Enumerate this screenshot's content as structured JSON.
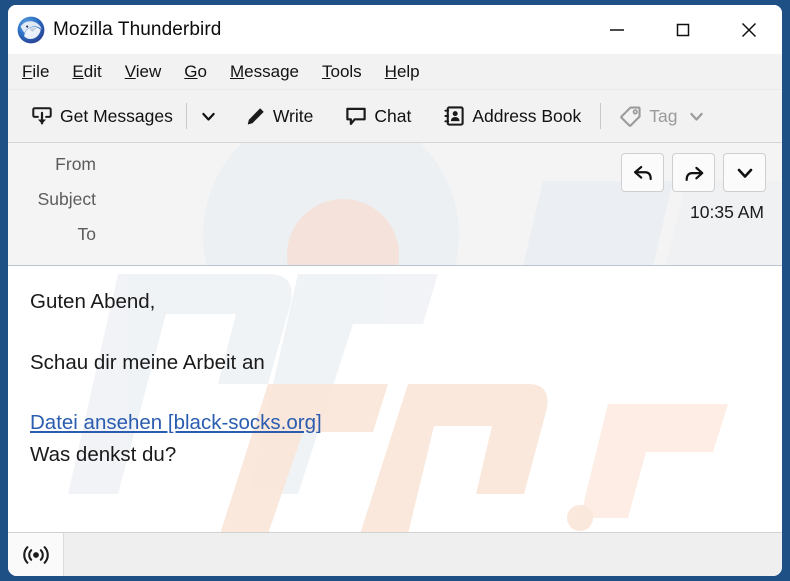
{
  "window": {
    "title": "Mozilla Thunderbird",
    "logo_icon": "thunderbird-logo",
    "controls": {
      "minimize": "minimize-icon",
      "maximize": "maximize-icon",
      "close": "close-icon"
    }
  },
  "menubar": {
    "items": [
      {
        "accesskey": "F",
        "rest": "ile"
      },
      {
        "accesskey": "E",
        "rest": "dit"
      },
      {
        "accesskey": "V",
        "rest": "iew"
      },
      {
        "accesskey": "G",
        "rest": "o"
      },
      {
        "accesskey": "M",
        "rest": "essage"
      },
      {
        "accesskey": "T",
        "rest": "ools"
      },
      {
        "accesskey": "H",
        "rest": "elp"
      }
    ]
  },
  "toolbar": {
    "get_messages_label": "Get Messages",
    "get_messages_icon": "inbox-download-icon",
    "get_messages_chevron": "chevron-down-icon",
    "write_label": "Write",
    "write_icon": "pencil-icon",
    "chat_label": "Chat",
    "chat_icon": "speech-bubble-icon",
    "address_book_label": "Address Book",
    "address_book_icon": "address-book-icon",
    "tag_label": "Tag",
    "tag_icon": "tag-icon",
    "tag_chevron": "chevron-down-icon",
    "tag_disabled": true
  },
  "message_header": {
    "rows": [
      {
        "label": "From",
        "value": ""
      },
      {
        "label": "Subject",
        "value": ""
      },
      {
        "label": "To",
        "value": ""
      }
    ],
    "time": "10:35 AM",
    "actions": {
      "reply": "reply-arrow-icon",
      "forward": "forward-arrow-icon",
      "more": "chevron-down-icon"
    }
  },
  "message_body": {
    "greeting": "Guten Abend,",
    "line1": "Schau dir meine Arbeit an",
    "link_text": "Datei ansehen [black-socks.org]",
    "closing": "Was denkst du?"
  },
  "statusbar": {
    "icon": "broadcast-signal-icon",
    "text": ""
  },
  "colors": {
    "desktop": "#1f5085",
    "titlebar": "#ffffff",
    "toolbar": "#f2f2f2",
    "header_pane": "#f4f4f4",
    "link": "#2a5db0",
    "disabled_text": "#9b9b9b",
    "body_text": "#1a1a1a"
  },
  "watermark": {
    "text": "PCrisk.com"
  }
}
